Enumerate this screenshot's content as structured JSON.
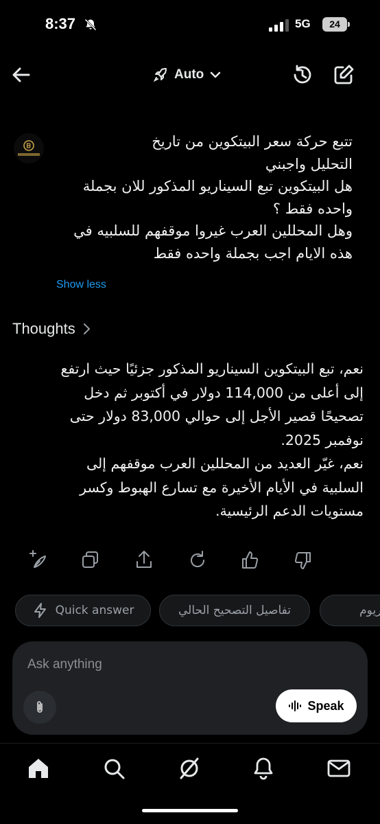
{
  "status_bar": {
    "time": "8:37",
    "network": "5G",
    "battery": "24"
  },
  "header": {
    "mode_label": "Auto"
  },
  "user_message": {
    "lines": [
      "تتبع حركة سعر البيتكوين من تاريخ",
      "التحليل واجبني",
      "هل البيتكوين تبع السيناريو المذكور للان بجملة",
      "واحده فقط ؟",
      "وهل المحللين العرب غيروا موقفهم للسلبيه في",
      "هذه الايام اجب بجملة واحده فقط"
    ],
    "show_less": "Show less"
  },
  "thoughts": {
    "label": "Thoughts"
  },
  "answer": {
    "lines": [
      "نعم، تبع البيتكوين السيناريو المذكور جزئيًا حيث ارتفع",
      "إلى أعلى من 114,000 دولار في أكتوبر ثم دخل",
      "تصحيحًا قصير الأجل إلى حوالي 83,000 دولار حتى",
      "نوفمبر 2025.",
      "نعم، غيّر العديد من المحللين العرب موقفهم إلى",
      "السلبية في الأيام الأخيرة مع تسارع الهبوط وكسر",
      "مستويات الدعم الرئيسية."
    ]
  },
  "suggestions": [
    {
      "label": "Quick answer",
      "icon": "lightning-icon"
    },
    {
      "label": "تفاصيل التصحيح الحالي"
    },
    {
      "label": "الإيثيريوم"
    }
  ],
  "composer": {
    "placeholder": "Ask anything",
    "speak_label": "Speak"
  },
  "colors": {
    "background": "#000000",
    "link": "#1d9bf0",
    "chip_bg": "#16181a",
    "input_bg": "#1f2124"
  }
}
